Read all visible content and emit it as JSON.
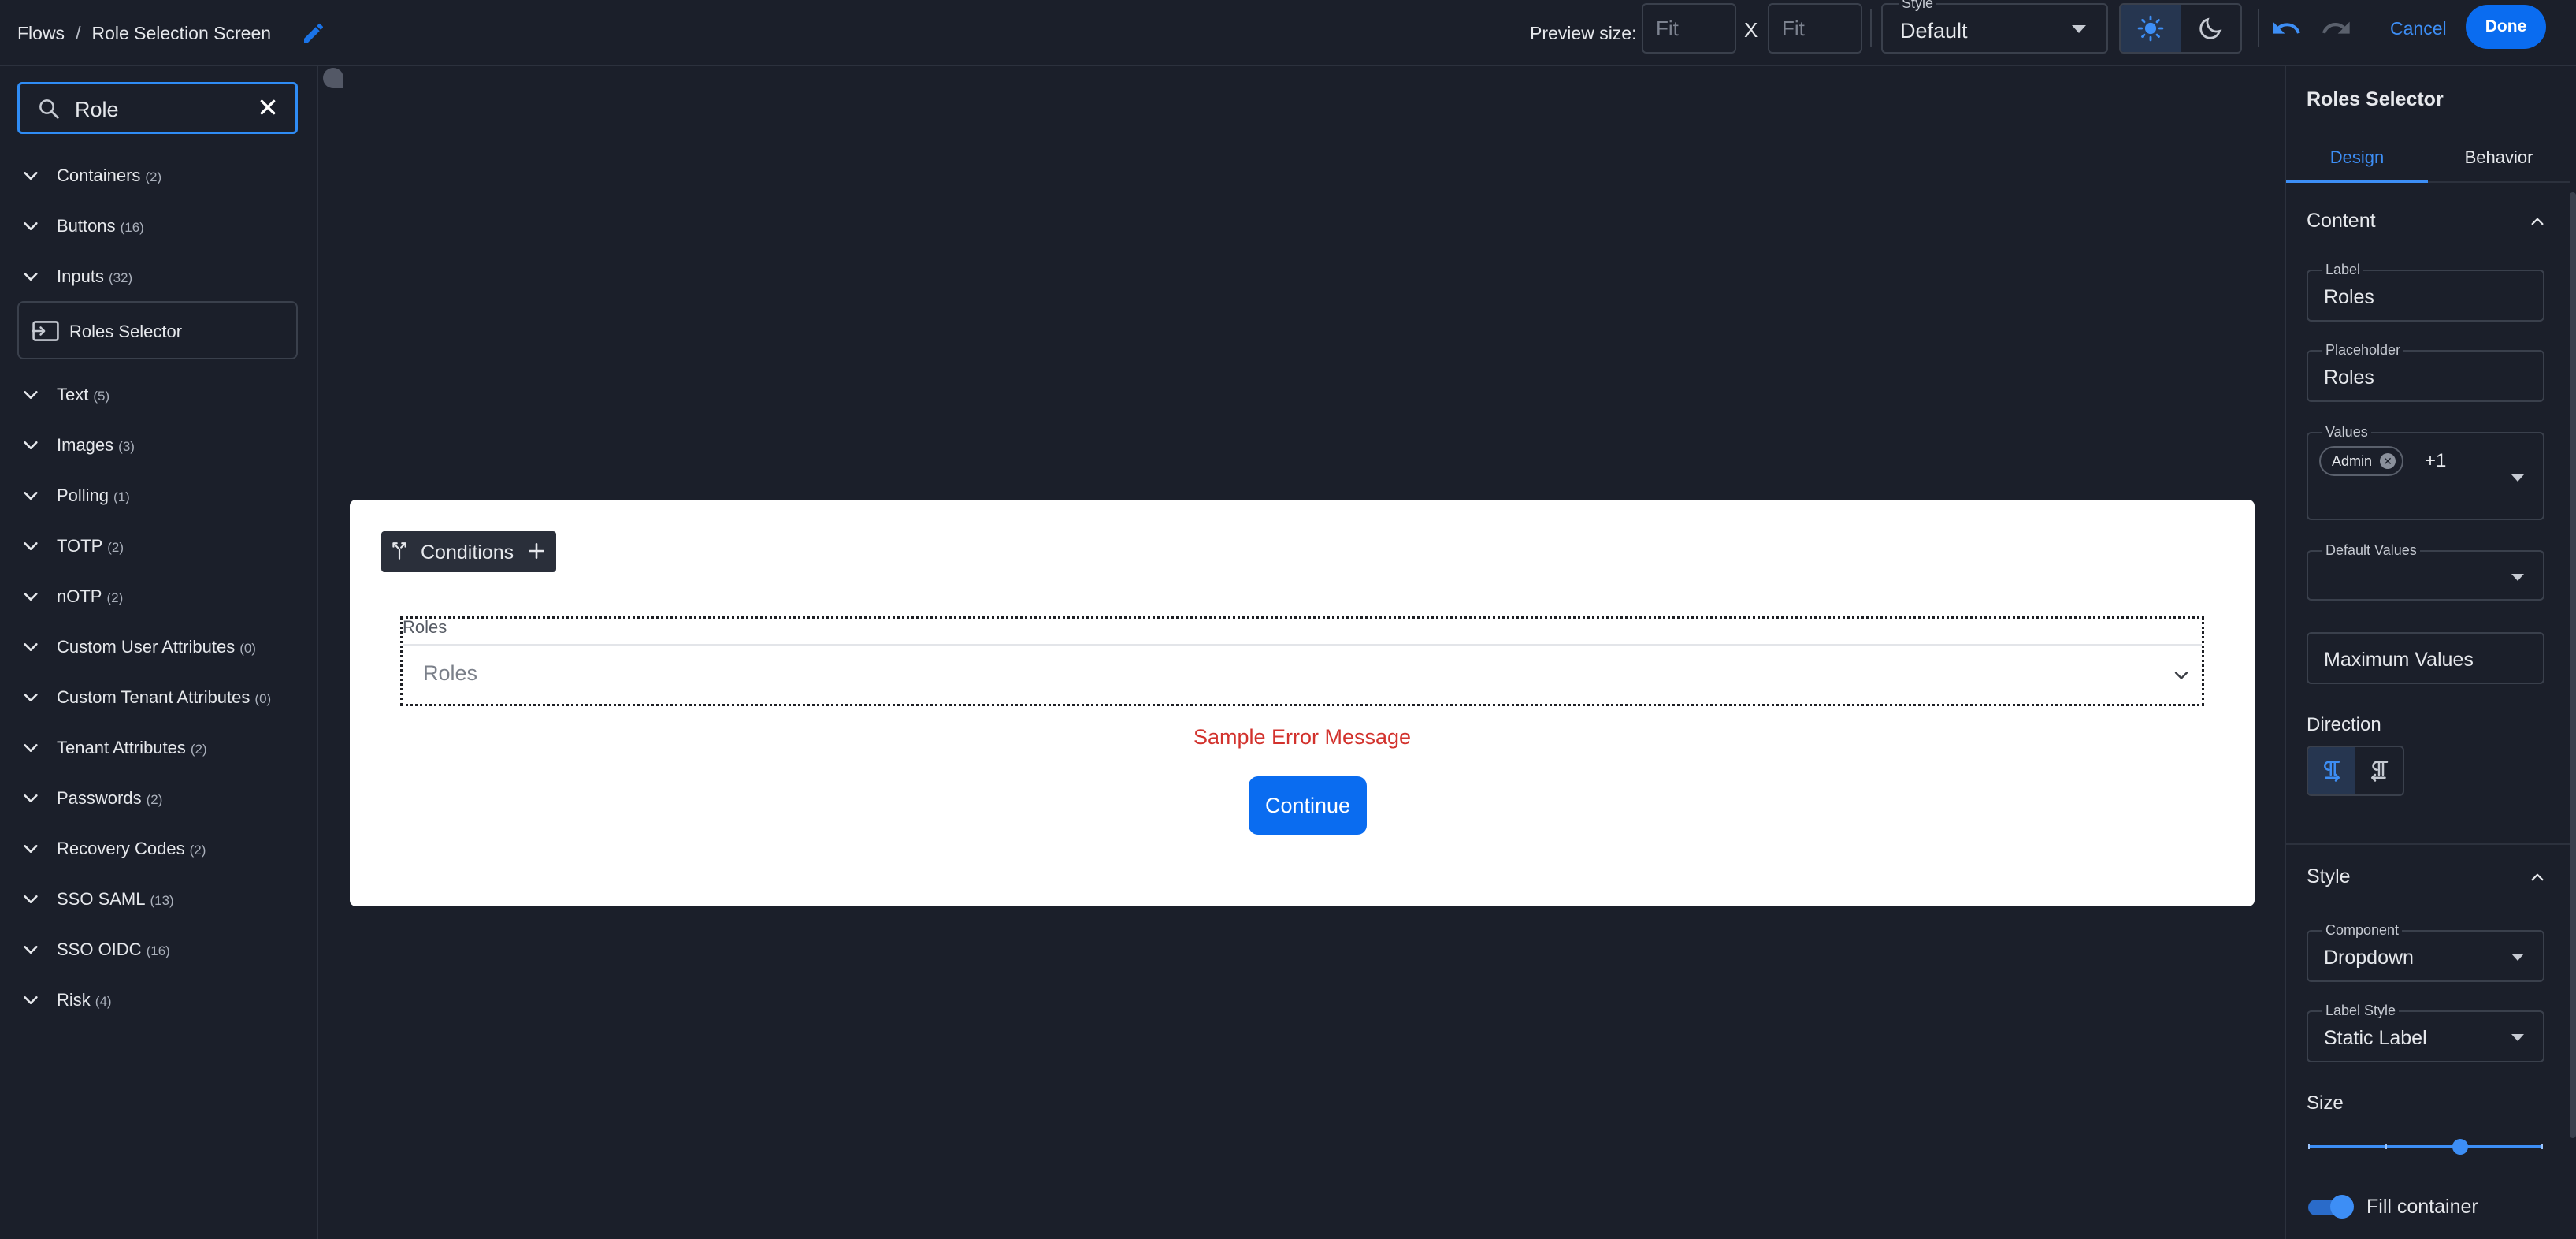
{
  "topbar": {
    "breadcrumb_root": "Flows",
    "breadcrumb_sep": "/",
    "breadcrumb_current": "Role Selection Screen",
    "preview_label": "Preview size:",
    "preview_width_placeholder": "Fit",
    "preview_height_placeholder": "Fit",
    "preview_x": "X",
    "style_legend": "Style",
    "style_value": "Default",
    "cancel_label": "Cancel",
    "done_label": "Done"
  },
  "search": {
    "value": "Role"
  },
  "categories": [
    {
      "label": "Containers",
      "count": "(2)"
    },
    {
      "label": "Buttons",
      "count": "(16)"
    },
    {
      "label": "Inputs",
      "count": "(32)"
    },
    {
      "label": "Text",
      "count": "(5)"
    },
    {
      "label": "Images",
      "count": "(3)"
    },
    {
      "label": "Polling",
      "count": "(1)"
    },
    {
      "label": "TOTP",
      "count": "(2)"
    },
    {
      "label": "nOTP",
      "count": "(2)"
    },
    {
      "label": "Custom User Attributes",
      "count": "(0)"
    },
    {
      "label": "Custom Tenant Attributes",
      "count": "(0)"
    },
    {
      "label": "Tenant Attributes",
      "count": "(2)"
    },
    {
      "label": "Passwords",
      "count": "(2)"
    },
    {
      "label": "Recovery Codes",
      "count": "(2)"
    },
    {
      "label": "SSO SAML",
      "count": "(13)"
    },
    {
      "label": "SSO OIDC",
      "count": "(16)"
    },
    {
      "label": "Risk",
      "count": "(4)"
    }
  ],
  "search_result": {
    "label": "Roles Selector"
  },
  "canvas": {
    "conditions_label": "Conditions",
    "field_label": "Roles",
    "field_placeholder": "Roles",
    "error_message": "Sample Error Message",
    "continue_label": "Continue"
  },
  "inspector": {
    "title": "Roles Selector",
    "tab_design": "Design",
    "tab_behavior": "Behavior",
    "content_heading": "Content",
    "label_legend": "Label",
    "label_value": "Roles",
    "placeholder_legend": "Placeholder",
    "placeholder_value": "Roles",
    "values_legend": "Values",
    "values_chip": "Admin",
    "values_more": "+1",
    "default_values_legend": "Default Values",
    "max_values_placeholder": "Maximum Values",
    "direction_heading": "Direction",
    "style_heading": "Style",
    "component_legend": "Component",
    "component_value": "Dropdown",
    "label_style_legend": "Label Style",
    "label_style_value": "Static Label",
    "size_heading": "Size",
    "size_level": 0.66,
    "fill_container_label": "Fill container",
    "fill_container_on": true
  },
  "colors": {
    "background": "#1b1f2a",
    "accent": "#0a6cf0",
    "link": "#3d8ef5",
    "error": "#d2322d",
    "card": "#ffffff"
  },
  "icons": {
    "edit": "pencil-icon",
    "theme_light": "sun-icon",
    "theme_dark": "moon-icon",
    "undo": "undo-icon",
    "redo": "redo-icon",
    "search": "search-icon",
    "clear": "close-icon",
    "category": "chevron-down-icon",
    "result": "input-field-icon",
    "conditions": "branch-icon",
    "add": "plus-icon",
    "direction_ltr": "ltr-direction-icon",
    "direction_rtl": "rtl-direction-icon"
  }
}
